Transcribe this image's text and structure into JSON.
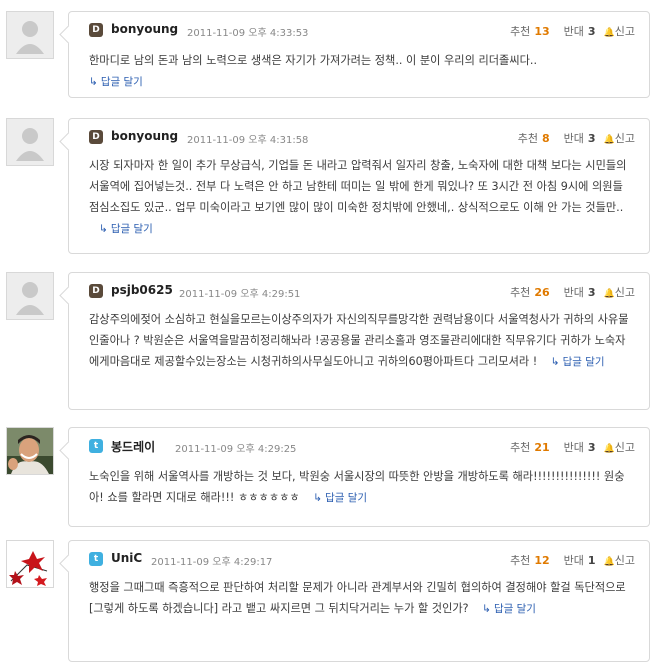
{
  "ui": {
    "upvote_label": "추천",
    "downvote_label": "반대",
    "report_label": "신고",
    "report_icon": "🔔",
    "reply_label": "답글 달기",
    "reply_icon": "↳"
  },
  "comments": [
    {
      "nickname": "bonyoung",
      "source": "daum",
      "source_icon": "D",
      "timestamp": "2011-11-09 오후 4:33:53",
      "up": "13",
      "down": "3",
      "text": "한마디로 남의 돈과 남의 노력으로 생색은 자기가 가져가려는 정책.. 이 분이 우리의 리더졸씨다.."
    },
    {
      "nickname": "bonyoung",
      "source": "daum",
      "source_icon": "D",
      "timestamp": "2011-11-09 오후 4:31:58",
      "up": "8",
      "down": "3",
      "text": "시장 되자마자 한 일이 추가 무상급식, 기업들 돈 내라고 압력줘서 일자리 창출, 노숙자에 대한 대책 보다는 시민들의 서울역에 집어넣는것.. 전부 다 노력은 안 하고 남한테 떠미는 일 밖에 한게 뭐있나? 또 3시간 전 아침 9시에 의원들 점심소집도 있군.. 업무 미숙이라고 보기엔 많이 많이 미숙한 정치밖에 안했네,. 상식적으로도 이해 안 가는 것들만.."
    },
    {
      "nickname": "psjb0625",
      "source": "daum",
      "source_icon": "D",
      "timestamp": "2011-11-09 오후 4:29:51",
      "up": "26",
      "down": "3",
      "text": "감상주의에젖어 소심하고 현실을모르는이상주의자가 자신의직무를망각한 권력남용이다 서울역청사가 귀하의 사유물인줄아나 ? 박원순은 서울역을말끔히정리해놔라 !공공용물 관리소홀과 영조물관리에대한 직무유기다 귀하가 노숙자에게마음대로 제공할수있는장소는 시청귀하의사무실도아니고 귀하의60평아파트다 그리모셔라 !"
    },
    {
      "nickname": "봉드레이",
      "source": "twitter",
      "source_icon": "t",
      "timestamp": "2011-11-09 오후 4:29:25",
      "up": "21",
      "down": "3",
      "text": "노숙인을 위해 서울역사를 개방하는 것 보다, 박원숭 서울시장의 따뜻한 안방을 개방하도록 해라!!!!!!!!!!!!!!! 원숭아! 쇼를 할라면 지대로 해라!!! ㅎㅎㅎㅎㅎㅎ"
    },
    {
      "nickname": "UniC",
      "source": "twitter",
      "source_icon": "t",
      "timestamp": "2011-11-09 오후 4:29:17",
      "up": "12",
      "down": "1",
      "text": "행정을 그때그때 즉흥적으로 판단하여 처리할 문제가 아니라 관계부서와 긴밀히 협의하여 결정해야 할걸 독단적으로 [그렇게 하도록 하겠습니다] 라고 뱉고 싸지르면 그 뒤치닥거리는 누가 할 것인가?"
    }
  ]
}
